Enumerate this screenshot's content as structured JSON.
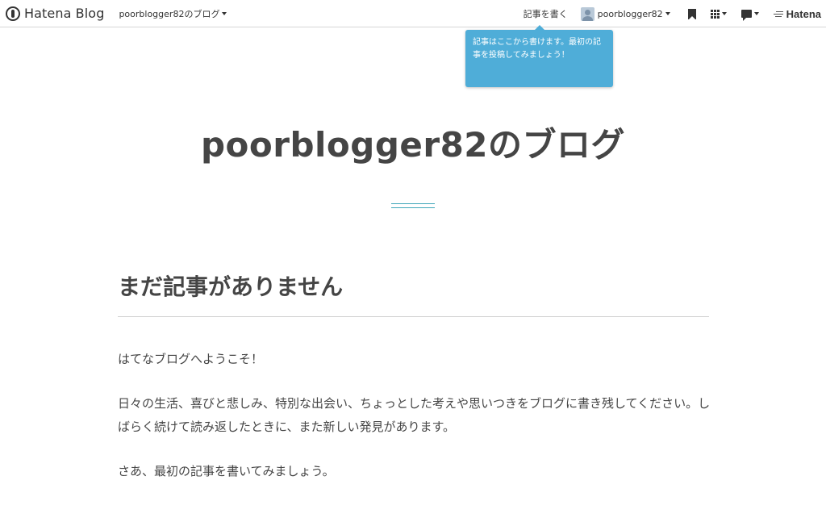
{
  "header": {
    "brand_name": "Hatena Blog",
    "blog_switch_label": "poorblogger82のブログ",
    "write_label": "記事を書く",
    "username": "poorblogger82",
    "hatena_label": "Hatena",
    "icons": [
      "hatena-blog-logo-icon",
      "avatar-icon",
      "bookmark-icon",
      "apps-grid-icon",
      "comment-icon",
      "hatena-logo-icon"
    ]
  },
  "tooltip": {
    "text": "記事はここから書けます。最初の記事を投稿してみましょう！",
    "color": "#4fadd8"
  },
  "blog": {
    "title": "poorblogger82のブログ",
    "accent_color": "#3fa6b9"
  },
  "entry": {
    "title": "まだ記事がありません",
    "paragraphs": [
      "はてなブログへようこそ！",
      "日々の生活、喜びと悲しみ、特別な出会い、ちょっとした考えや思いつきをブログに書き残してください。しばらく続けて読み返したときに、また新しい発見があります。",
      "さあ、最初の記事を書いてみましょう。"
    ]
  }
}
